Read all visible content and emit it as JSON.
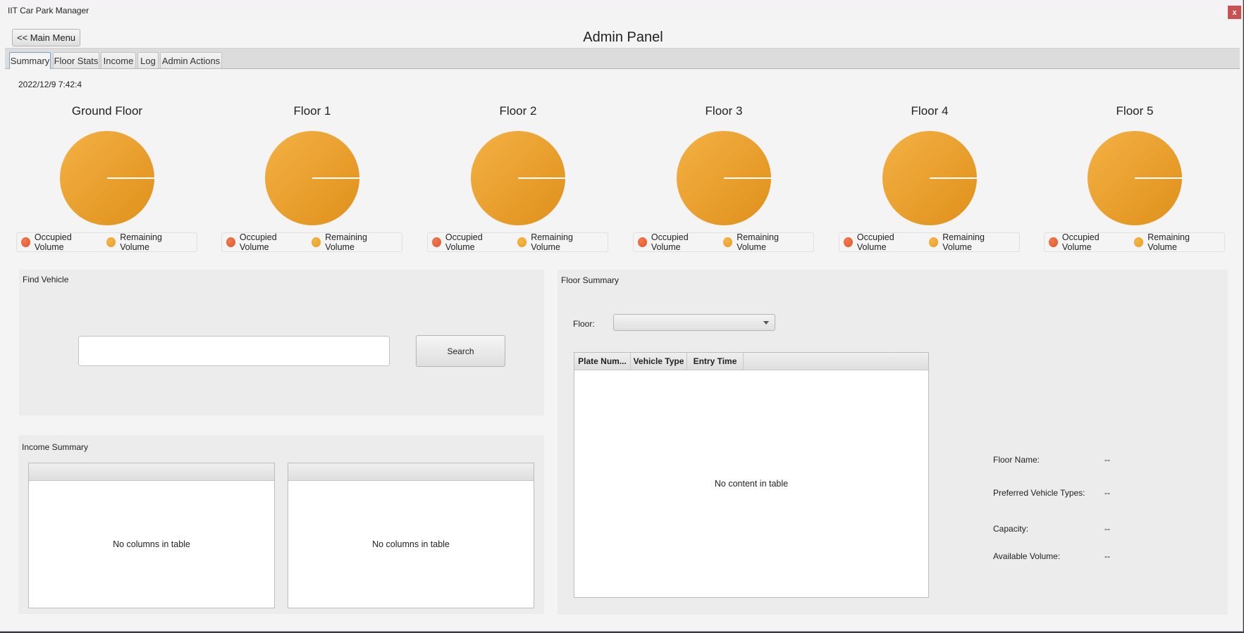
{
  "window": {
    "app_title": "IIT Car Park Manager",
    "close_label": "x"
  },
  "header": {
    "main_menu_label": "<< Main Menu",
    "title": "Admin Panel"
  },
  "tabs": [
    {
      "label": "Summary",
      "active": true
    },
    {
      "label": "Floor Stats",
      "active": false
    },
    {
      "label": "Income",
      "active": false
    },
    {
      "label": "Log",
      "active": false
    },
    {
      "label": "Admin Actions",
      "active": false
    }
  ],
  "timestamp": "2022/12/9 7:42:4",
  "legend": {
    "occupied_label": "Occupied Volume",
    "remaining_label": "Remaining Volume",
    "occupied_color": "#e0582c",
    "remaining_color": "#e99e22"
  },
  "chart_data": [
    {
      "type": "pie",
      "title": "Ground Floor",
      "categories": [
        "Occupied Volume",
        "Remaining Volume"
      ],
      "values": [
        0,
        100
      ]
    },
    {
      "type": "pie",
      "title": "Floor 1",
      "categories": [
        "Occupied Volume",
        "Remaining Volume"
      ],
      "values": [
        0,
        100
      ]
    },
    {
      "type": "pie",
      "title": "Floor 2",
      "categories": [
        "Occupied Volume",
        "Remaining Volume"
      ],
      "values": [
        0,
        100
      ]
    },
    {
      "type": "pie",
      "title": "Floor 3",
      "categories": [
        "Occupied Volume",
        "Remaining Volume"
      ],
      "values": [
        0,
        100
      ]
    },
    {
      "type": "pie",
      "title": "Floor 4",
      "categories": [
        "Occupied Volume",
        "Remaining Volume"
      ],
      "values": [
        0,
        100
      ]
    },
    {
      "type": "pie",
      "title": "Floor 5",
      "categories": [
        "Occupied Volume",
        "Remaining Volume"
      ],
      "values": [
        0,
        100
      ]
    }
  ],
  "find_vehicle": {
    "title": "Find Vehicle",
    "input_value": "",
    "search_label": "Search"
  },
  "income_summary": {
    "title": "Income Summary",
    "tables": [
      {
        "placeholder": "No columns in table"
      },
      {
        "placeholder": "No columns in table"
      }
    ]
  },
  "floor_summary": {
    "title": "Floor Summary",
    "floor_label": "Floor:",
    "floor_selected": "",
    "table": {
      "columns": [
        "Plate Num...",
        "Vehicle Type",
        "Entry Time"
      ],
      "rows": [],
      "placeholder": "No content in table"
    },
    "info": [
      {
        "label": "Floor Name:",
        "value": "--"
      },
      {
        "label": "Preferred Vehicle Types:",
        "value": "--"
      },
      {
        "label": "Capacity:",
        "value": "--"
      },
      {
        "label": "Available Volume:",
        "value": "--"
      }
    ]
  }
}
